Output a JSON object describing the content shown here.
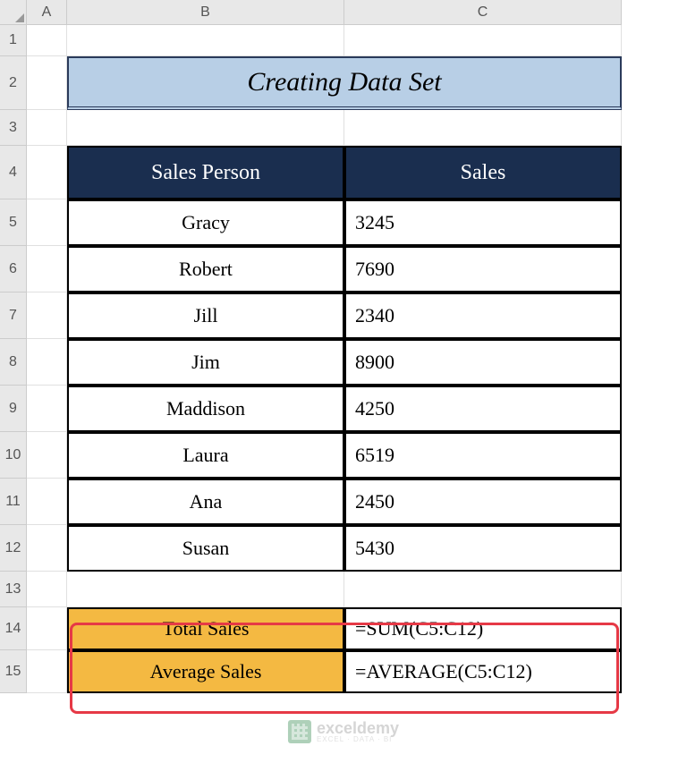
{
  "columns": [
    "A",
    "B",
    "C"
  ],
  "rows": [
    "1",
    "2",
    "3",
    "4",
    "5",
    "6",
    "7",
    "8",
    "9",
    "10",
    "11",
    "12",
    "13",
    "14",
    "15"
  ],
  "title": "Creating Data Set",
  "table": {
    "headers": {
      "col1": "Sales Person",
      "col2": "Sales"
    },
    "data": [
      {
        "person": "Gracy",
        "sales": "3245"
      },
      {
        "person": "Robert",
        "sales": "7690"
      },
      {
        "person": "Jill",
        "sales": "2340"
      },
      {
        "person": "Jim",
        "sales": "8900"
      },
      {
        "person": "Maddison",
        "sales": "4250"
      },
      {
        "person": "Laura",
        "sales": "6519"
      },
      {
        "person": "Ana",
        "sales": "2450"
      },
      {
        "person": "Susan",
        "sales": "5430"
      }
    ]
  },
  "summary": {
    "total_label": "Total Sales",
    "total_formula": "=SUM(C5:C12)",
    "average_label": "Average Sales",
    "average_formula": "=AVERAGE(C5:C12)"
  },
  "watermark": {
    "brand": "exceldemy",
    "sub": "EXCEL · DATA · BI"
  }
}
